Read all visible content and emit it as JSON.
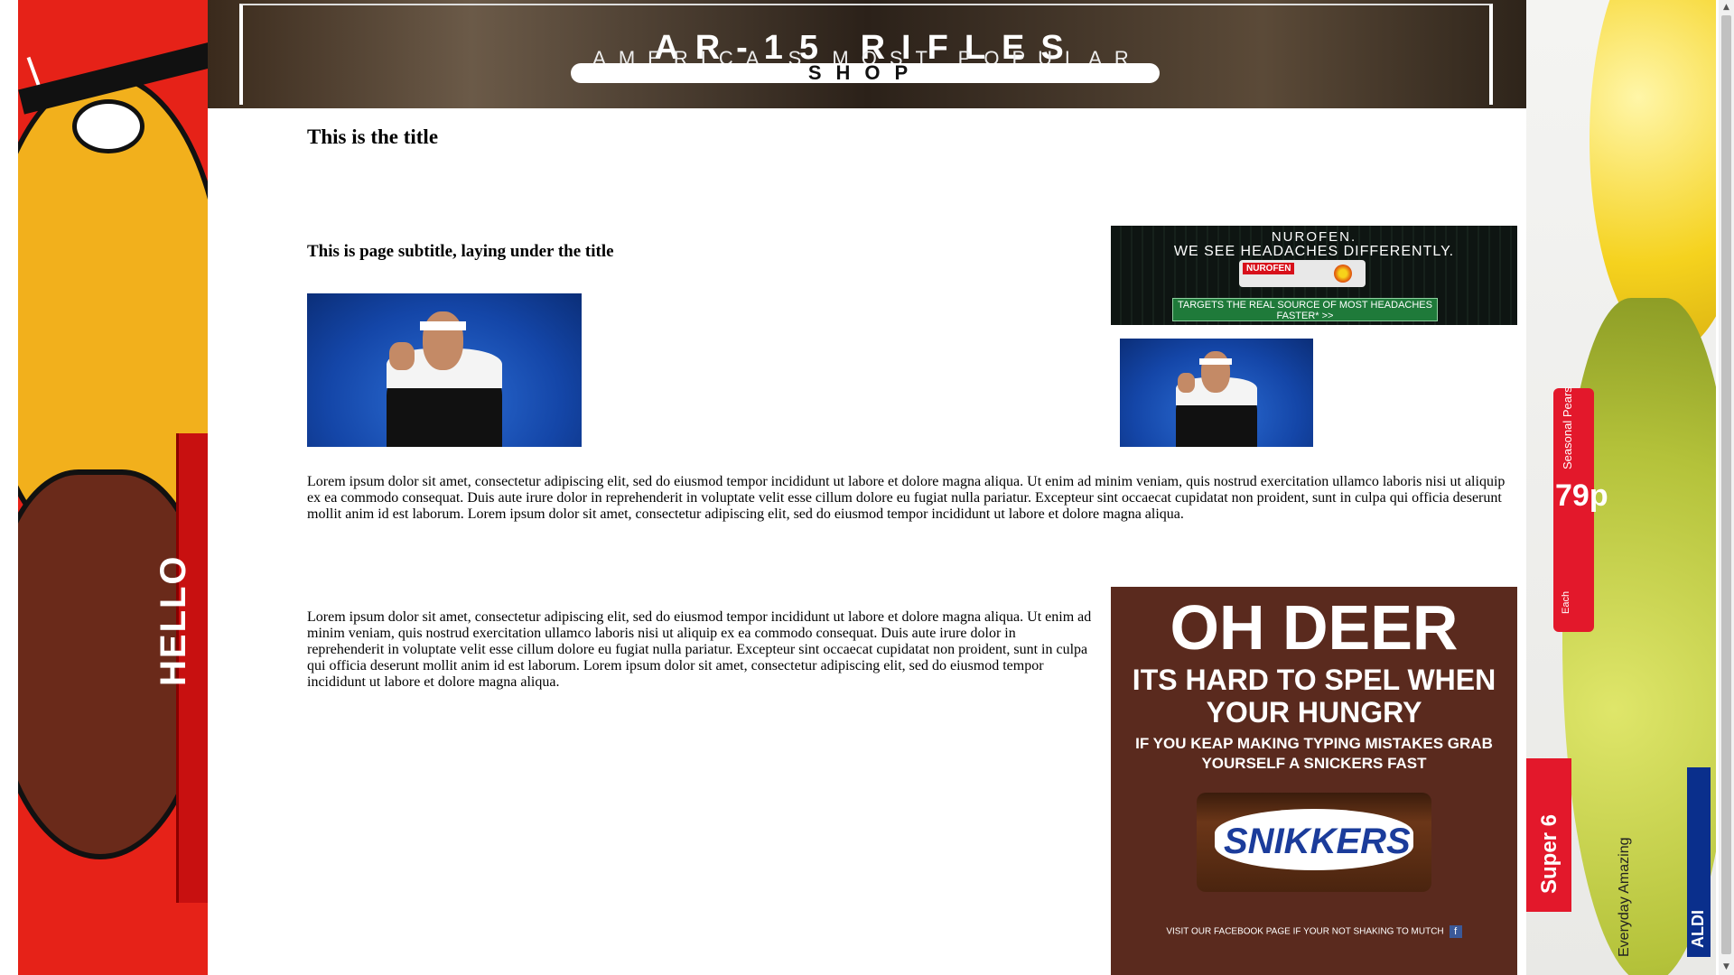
{
  "page": {
    "title": "This is the title",
    "subtitle": "This is page subtitle, laying under the title",
    "paragraph_1": "Lorem ipsum dolor sit amet, consectetur adipiscing elit, sed do eiusmod tempor incididunt ut labore et dolore magna aliqua. Ut enim ad minim veniam, quis nostrud exercitation ullamco laboris nisi ut aliquip ex ea commodo consequat. Duis aute irure dolor in reprehenderit in voluptate velit esse cillum dolore eu fugiat nulla pariatur. Excepteur sint occaecat cupidatat non proident, sunt in culpa qui officia deserunt mollit anim id est laborum. Lorem ipsum dolor sit amet, consectetur adipiscing elit, sed do eiusmod tempor incididunt ut labore et dolore magna aliqua.",
    "paragraph_2": "Lorem ipsum dolor sit amet, consectetur adipiscing elit, sed do eiusmod tempor incididunt ut labore et dolore magna aliqua. Ut enim ad minim veniam, quis nostrud exercitation ullamco laboris nisi ut aliquip ex ea commodo consequat. Duis aute irure dolor in reprehenderit in voluptate velit esse cillum dolore eu fugiat nulla pariatur. Excepteur sint occaecat cupidatat non proident, sunt in culpa qui officia deserunt mollit anim id est laborum. Lorem ipsum dolor sit amet, consectetur adipiscing elit, sed do eiusmod tempor incididunt ut labore et dolore magna aliqua."
  },
  "ads": {
    "top_banner": {
      "headline": "AR-15 RIFLES",
      "subline": "AMERICA'S MOST POPULAR",
      "button": "SHOP"
    },
    "nurofen": {
      "line1": "NUROFEN.",
      "line2": "WE SEE HEADACHES DIFFERENTLY.",
      "brand": "NUROFEN",
      "cta": "TARGETS THE REAL SOURCE OF MOST HEADACHES FASTER* >>"
    },
    "snickers": {
      "headline": "OH DEER",
      "line2": "ITS HARD TO SPEL WHEN YOUR HUNGRY",
      "line3": "IF YOU KEAP MAKING TYPING MISTAKES GRAB YOURSELF A SNICKERS FAST",
      "logo": "SNIKKERS",
      "footer": "VISIT OUR FACEBOOK PAGE IF YOUR NOT SHAKING TO MUTCH",
      "fb": "f"
    },
    "left": {
      "text": "HELLO"
    },
    "right": {
      "price_label": "Seasonal Pears",
      "price": "79p",
      "price_each": "Each",
      "super6": "Super 6",
      "aldi": "ALDI",
      "everyday": "Everyday Amazing"
    }
  },
  "colors": {
    "page_background": "#ffffff",
    "text": "#000000",
    "left_ad_red": "#e62218",
    "snickers_brown": "#5a2a1e",
    "snickers_blue": "#1b3c9b"
  },
  "scrollbar": {
    "up_icon": "▲",
    "down_icon": "▼"
  }
}
